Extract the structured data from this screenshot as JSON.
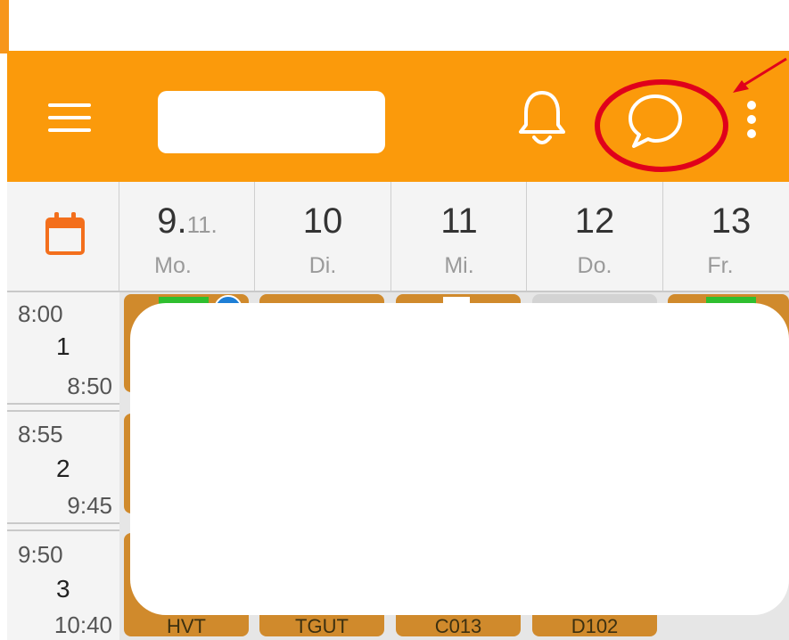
{
  "week": {
    "days": [
      {
        "number": "9.",
        "month": "11.",
        "name": "Mo."
      },
      {
        "number": "10",
        "month": "",
        "name": "Di."
      },
      {
        "number": "11",
        "month": "",
        "name": "Mi."
      },
      {
        "number": "12",
        "month": "",
        "name": "Do."
      },
      {
        "number": "13",
        "month": "",
        "name": "Fr."
      }
    ]
  },
  "periods": [
    {
      "start": "8:00",
      "number": "1",
      "end": "8:50"
    },
    {
      "start": "8:55",
      "number": "2",
      "end": "9:45"
    },
    {
      "start": "9:50",
      "number": "3",
      "end": "10:40"
    }
  ],
  "lessons_visible_text": {
    "mo": "HVT",
    "di": "TGUT",
    "mi": "C013",
    "do": "D102"
  },
  "icons": {
    "menu": "menu-icon",
    "bell": "bell-icon",
    "chat": "chat-icon",
    "more": "more-vertical-icon",
    "calendar": "calendar-icon"
  },
  "colors": {
    "app_bar": "#fb9a0b",
    "lesson": "#d08a2c",
    "highlight": "#e0001b",
    "calendar_icon": "#f36f1c"
  }
}
